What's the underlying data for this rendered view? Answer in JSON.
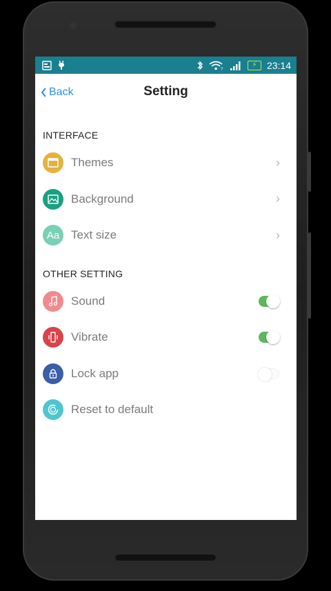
{
  "status_bar": {
    "time": "23:14"
  },
  "header": {
    "back_label": "Back",
    "title": "Setting"
  },
  "sections": {
    "interface": {
      "title": "INTERFACE",
      "items": [
        {
          "label": "Themes",
          "icon": "themes-icon",
          "color": "#e5b23d"
        },
        {
          "label": "Background",
          "icon": "background-icon",
          "color": "#1aa082"
        },
        {
          "label": "Text size",
          "icon": "text-size-icon",
          "icon_text": "Aa",
          "color": "#79d0b4"
        }
      ]
    },
    "other": {
      "title": "OTHER SETTING",
      "items": [
        {
          "label": "Sound",
          "icon": "music-note-icon",
          "color": "#f08a8e",
          "toggle": true
        },
        {
          "label": "Vibrate",
          "icon": "phone-vibrate-icon",
          "color": "#d9434a",
          "toggle": true
        },
        {
          "label": "Lock app",
          "icon": "lock-icon",
          "color": "#3a5ea8",
          "toggle": false
        },
        {
          "label": "Reset to default",
          "icon": "reset-icon",
          "color": "#4fc6cf"
        }
      ]
    }
  },
  "colors": {
    "status_bar": "#1a7f8e",
    "accent": "#2f8fe6",
    "toggle_on": "#5cb85c"
  }
}
